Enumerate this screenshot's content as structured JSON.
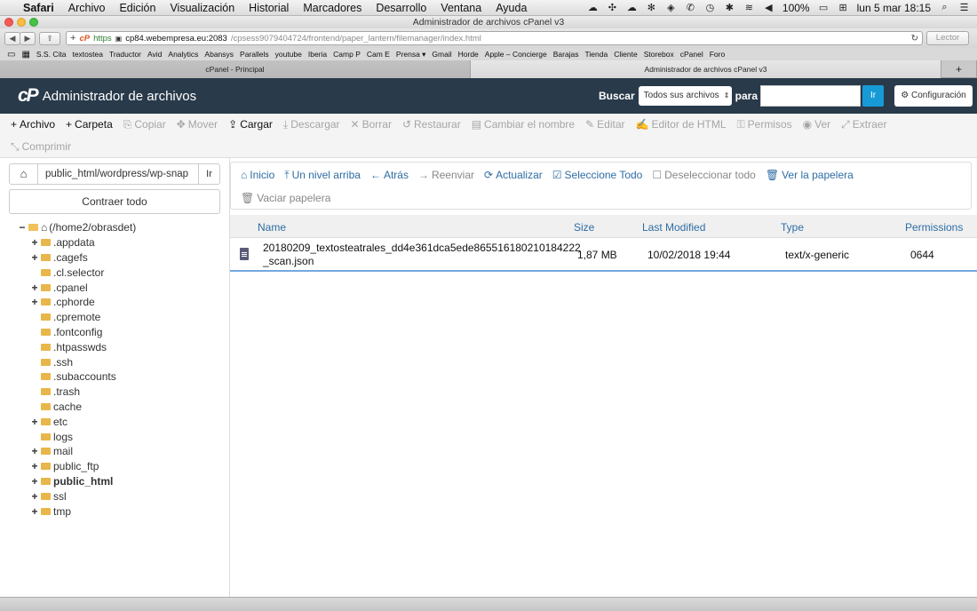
{
  "menubar": {
    "apple": "",
    "items": [
      "Safari",
      "Archivo",
      "Edición",
      "Visualización",
      "Historial",
      "Marcadores",
      "Desarrollo",
      "Ventana",
      "Ayuda"
    ],
    "battery": "100%",
    "clock": "lun 5 mar  18:15"
  },
  "window": {
    "title": "Administrador de archivos cPanel v3"
  },
  "addressbar": {
    "scheme": "https",
    "host": "cp84.webempresa.eu:2083",
    "path": "/cpsess9079404724/frontend/paper_lantern/filemanager/index.html",
    "reader": "Lector"
  },
  "bookmarks": [
    "S.S. Cita",
    "textostea",
    "Traductor",
    "Avid",
    "Analytics",
    "Abansys",
    "Parallels",
    "youtube",
    "Iberia",
    "Camp P",
    "Cam E",
    "Prensa ▾",
    "Gmail",
    "Horde",
    "Apple – Concierge",
    "Barajas",
    "Tienda",
    "Cliente",
    "Storebox",
    "cPanel",
    "Foro"
  ],
  "tabs": [
    "cPanel - Principal",
    "Administrador de archivos cPanel v3"
  ],
  "header": {
    "logo": "cP",
    "title": "Administrador de archivos",
    "search_label": "Buscar",
    "search_scope": "Todos sus archivos",
    "para": "para",
    "search_value": "",
    "go": "Ir",
    "settings": "Configuración"
  },
  "toolbar": {
    "row1": [
      {
        "icon": "+",
        "label": "Archivo",
        "enabled": true
      },
      {
        "icon": "+",
        "label": "Carpeta",
        "enabled": true
      },
      {
        "icon": "⎘",
        "label": "Copiar",
        "enabled": false
      },
      {
        "icon": "✥",
        "label": "Mover",
        "enabled": false
      },
      {
        "icon": "⇪",
        "label": "Cargar",
        "enabled": true
      },
      {
        "icon": "⤓",
        "label": "Descargar",
        "enabled": false
      },
      {
        "icon": "✕",
        "label": "Borrar",
        "enabled": false
      },
      {
        "icon": "↺",
        "label": "Restaurar",
        "enabled": false
      },
      {
        "icon": "▤",
        "label": "Cambiar el nombre",
        "enabled": false
      },
      {
        "icon": "✎",
        "label": "Editar",
        "enabled": false
      },
      {
        "icon": "✍",
        "label": "Editor de HTML",
        "enabled": false
      },
      {
        "icon": "⚿",
        "label": "Permisos",
        "enabled": false
      },
      {
        "icon": "◉",
        "label": "Ver",
        "enabled": false
      },
      {
        "icon": "⤢",
        "label": "Extraer",
        "enabled": false
      }
    ],
    "row2": [
      {
        "icon": "⤡",
        "label": "Comprimir",
        "enabled": false
      }
    ]
  },
  "leftpane": {
    "path_value": "public_html/wordpress/wp-snap",
    "go": "Ir",
    "collapse": "Contraer todo",
    "tree": [
      {
        "label": "(/home2/obrasdet)",
        "level": 0,
        "toggle": "−",
        "root": true
      },
      {
        "label": ".appdata",
        "level": 1,
        "toggle": "+"
      },
      {
        "label": ".cagefs",
        "level": 1,
        "toggle": "+"
      },
      {
        "label": ".cl.selector",
        "level": 1,
        "toggle": ""
      },
      {
        "label": ".cpanel",
        "level": 1,
        "toggle": "+"
      },
      {
        "label": ".cphorde",
        "level": 1,
        "toggle": "+"
      },
      {
        "label": ".cpremote",
        "level": 1,
        "toggle": ""
      },
      {
        "label": ".fontconfig",
        "level": 1,
        "toggle": ""
      },
      {
        "label": ".htpasswds",
        "level": 1,
        "toggle": ""
      },
      {
        "label": ".ssh",
        "level": 1,
        "toggle": ""
      },
      {
        "label": ".subaccounts",
        "level": 1,
        "toggle": ""
      },
      {
        "label": ".trash",
        "level": 1,
        "toggle": ""
      },
      {
        "label": "cache",
        "level": 1,
        "toggle": ""
      },
      {
        "label": "etc",
        "level": 1,
        "toggle": "+"
      },
      {
        "label": "logs",
        "level": 1,
        "toggle": ""
      },
      {
        "label": "mail",
        "level": 1,
        "toggle": "+"
      },
      {
        "label": "public_ftp",
        "level": 1,
        "toggle": "+"
      },
      {
        "label": "public_html",
        "level": 1,
        "toggle": "+",
        "bold": true
      },
      {
        "label": "ssl",
        "level": 1,
        "toggle": "+"
      },
      {
        "label": "tmp",
        "level": 1,
        "toggle": "+"
      }
    ]
  },
  "navbar": {
    "row1": [
      {
        "icon": "⌂",
        "label": "Inicio",
        "enabled": true
      },
      {
        "icon": "⤒",
        "label": "Un nivel arriba",
        "enabled": true
      },
      {
        "icon": "←",
        "label": "Atrás",
        "enabled": true
      },
      {
        "icon": "→",
        "label": "Reenviar",
        "enabled": false
      },
      {
        "icon": "⟳",
        "label": "Actualizar",
        "enabled": true
      },
      {
        "icon": "☑",
        "label": "Seleccione Todo",
        "enabled": true
      },
      {
        "icon": "☐",
        "label": "Deseleccionar todo",
        "enabled": false
      },
      {
        "icon": "🗑",
        "label": "Ver la papelera",
        "enabled": true
      }
    ],
    "row2": [
      {
        "icon": "🗑",
        "label": "Vaciar papelera",
        "enabled": false
      }
    ]
  },
  "filetable": {
    "columns": {
      "name": "Name",
      "size": "Size",
      "modified": "Last Modified",
      "type": "Type",
      "perms": "Permissions"
    },
    "rows": [
      {
        "name_line1": "20180209_textosteatrales_dd4e361dca5ede865516180210184222",
        "name_line2": "_scan.json",
        "size": "1,87 MB",
        "modified": "10/02/2018 19:44",
        "type": "text/x-generic",
        "perms": "0644"
      }
    ]
  },
  "colors": {
    "header": "#293a4a",
    "link": "#2e6da4",
    "accent": "#179bd7",
    "folder": "#e8b64a"
  }
}
